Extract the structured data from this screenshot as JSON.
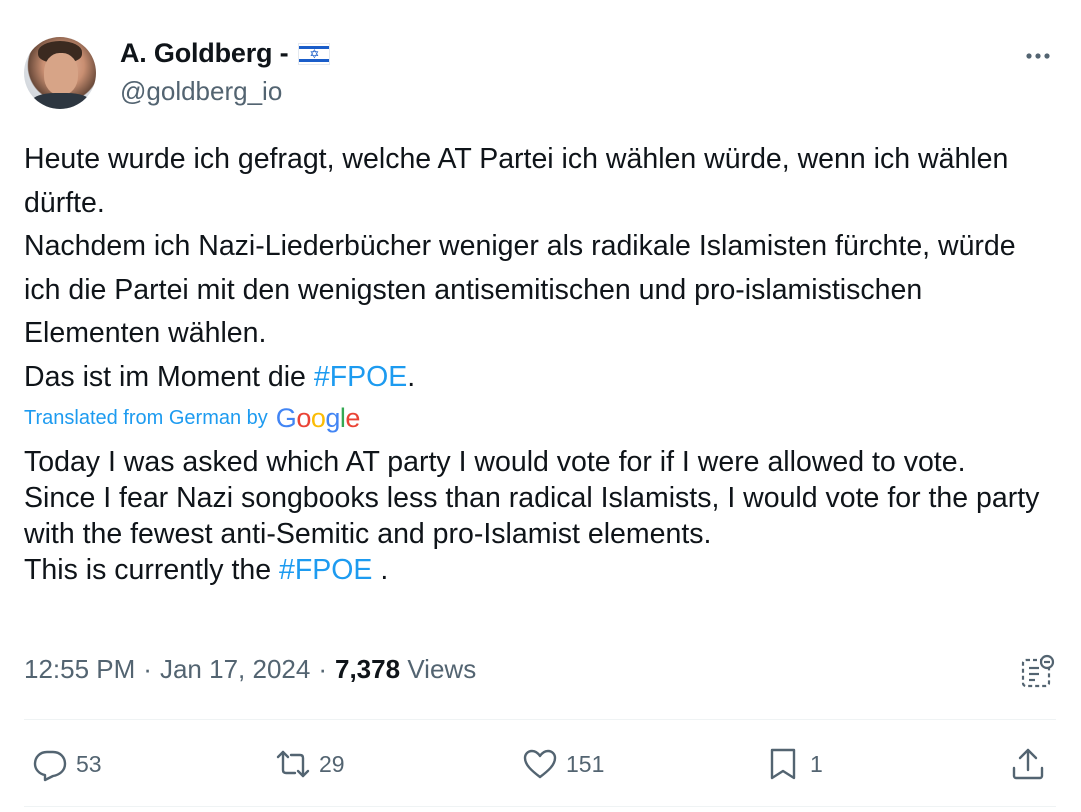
{
  "author": {
    "display_name": "A. Goldberg -",
    "flag": "🇮🇱",
    "flag_star": "✡",
    "handle": "@goldberg_io"
  },
  "post": {
    "original_lines": [
      "Heute wurde ich gefragt, welche AT Partei ich wählen würde, wenn ich wählen dürfte.",
      "Nachdem ich Nazi-Liederbücher weniger als radikale Islamisten fürchte, würde ich die Partei mit den wenigsten antisemitischen und pro-islamistischen Elementen wählen.",
      "Das ist im Moment die "
    ],
    "original_hashtag": "#FPOE",
    "original_tail": ".",
    "translated_label": "Translated from German by",
    "translator_logo": [
      "G",
      "o",
      "o",
      "g",
      "l",
      "e"
    ],
    "translation_lines": [
      "Today I was asked which AT party I would vote for if I were allowed to vote.",
      "Since I fear Nazi songbooks less than radical Islamists, I would vote for the party with the fewest anti-Semitic and pro-Islamist elements.",
      "This is currently the "
    ],
    "translation_hashtag": "#FPOE",
    "translation_tail": " ."
  },
  "meta": {
    "time": "12:55 PM",
    "sep1": "·",
    "date": "Jan 17, 2024",
    "sep2": "·",
    "views_count": "7,378",
    "views_label": "Views"
  },
  "actions": {
    "replies": "53",
    "reposts": "29",
    "likes": "151",
    "bookmarks": "1"
  },
  "colors": {
    "accent": "#1d9bf0",
    "text": "#0f1419",
    "secondary": "#536471",
    "divider": "#eff3f4"
  },
  "icons": [
    "more-icon",
    "flag-israel-icon",
    "google-logo",
    "analytics-icon",
    "reply-icon",
    "repost-icon",
    "like-icon",
    "bookmark-icon",
    "share-icon"
  ]
}
